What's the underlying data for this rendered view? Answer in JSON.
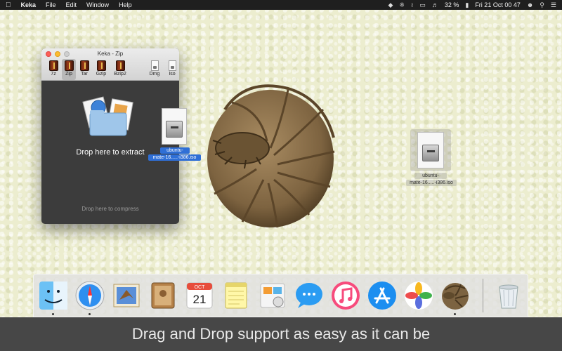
{
  "menubar": {
    "apple": "",
    "items": [
      "Keka",
      "File",
      "Edit",
      "Window",
      "Help"
    ],
    "battery": "32 %",
    "datetime": "Fri 21 Oct  00 47"
  },
  "window": {
    "title": "Keka - Zip",
    "formats": [
      {
        "label": "7z"
      },
      {
        "label": "Zip"
      },
      {
        "label": "Tar"
      },
      {
        "label": "Gzip"
      },
      {
        "label": "Bzip2"
      },
      {
        "label": "Dmg"
      },
      {
        "label": "Iso"
      }
    ],
    "selected_format": "Zip",
    "extract_label": "Drop here to extract",
    "compress_label": "Drop here to compress"
  },
  "dragged_file": {
    "name_line1": "ubuntu-",
    "name_line2": "mate-16.....-i386.iso"
  },
  "desktop_file": {
    "name_line1": "ubuntu-",
    "name_line2": "mate-16.....-i386.iso"
  },
  "dock": {
    "apps": [
      "finder",
      "safari",
      "mail",
      "contacts",
      "calendar",
      "notes",
      "reminders",
      "messages",
      "itunes",
      "app-store",
      "photos",
      "keka"
    ],
    "trash": "trash",
    "calendar_month": "OCT",
    "calendar_day": "21"
  },
  "caption": "Drag and Drop support as easy as it can be",
  "colors": {
    "menubar": "#1f1f1f",
    "selection": "#2f6fd6",
    "caption_bg": "#474747"
  }
}
